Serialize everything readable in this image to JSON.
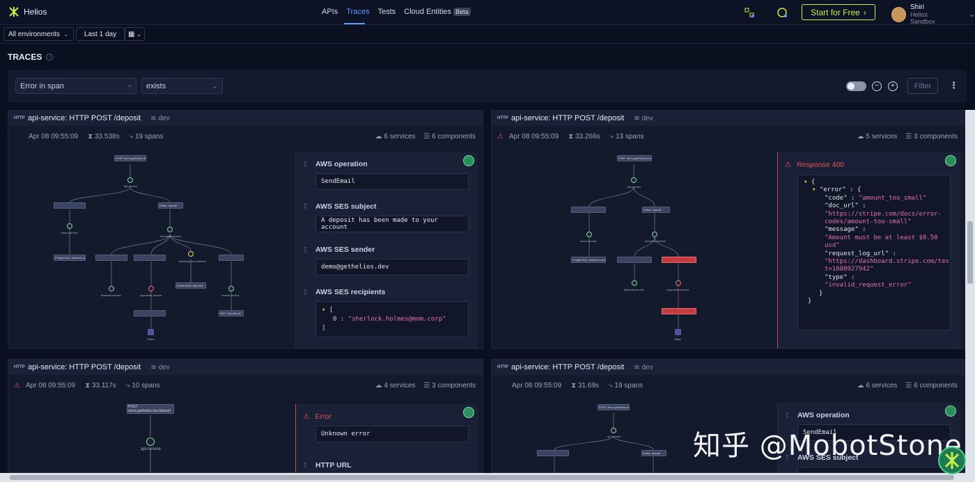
{
  "brand": {
    "name": "Helios"
  },
  "nav": {
    "items": [
      "APIs",
      "Traces",
      "Tests",
      "Cloud Entities"
    ],
    "beta": "Beta",
    "active": "Traces"
  },
  "header": {
    "cta": "Start for Free",
    "user_name": "Shiri",
    "user_org": "Helios Sandbox"
  },
  "toolbar": {
    "environment": "All environments",
    "time_range": "Last 1 day"
  },
  "page": {
    "title": "TRACES"
  },
  "filter": {
    "field": "Error in span",
    "operator": "exists",
    "button": "Filter"
  },
  "cards": [
    {
      "title": "api-service: HTTP POST /deposit",
      "env": "dev",
      "time": "Apr 08 09:55:09",
      "duration": "33.538s",
      "spans": "19 spans",
      "services": "6 services",
      "components": "6 components",
      "error": false,
      "panel": {
        "type": "aws",
        "fields": [
          {
            "label": "AWS operation",
            "value": "SendEmail"
          },
          {
            "label": "AWS SES subject",
            "value": "A deposit has been made to your account"
          },
          {
            "label": "AWS SES sender",
            "value": "demo@gethelios.dev"
          },
          {
            "label": "AWS SES recipients",
            "value": "\"sherlock.holmes@mom.corp\""
          }
        ]
      }
    },
    {
      "title": "api-service: HTTP POST /deposit",
      "env": "dev",
      "time": "Apr 08 09:55:09",
      "duration": "33.266s",
      "spans": "13 spans",
      "services": "5 services",
      "components": "3 components",
      "error": true,
      "panel": {
        "type": "response",
        "label": "Response 400",
        "json": {
          "code": "\"amount_too_small\"",
          "doc_url_1": "\"https://stripe.com/docs/error-",
          "doc_url_2": "codes/amount-too-small\"",
          "message_1": "\"Amount must be at least $0.50",
          "message_2": "usd\"",
          "req_1": "\"https://dashboard.stripe.com/tes",
          "req_2": "t=1680927942\"",
          "type": "\"invalid_request_error\""
        }
      }
    },
    {
      "title": "api-service: HTTP POST /deposit",
      "env": "dev",
      "time": "Apr 08 09:55:09",
      "duration": "33.117s",
      "spans": "10 spans",
      "services": "4 services",
      "components": "3 components",
      "error": true,
      "panel": {
        "type": "error",
        "label": "Error",
        "value": "Unknown error",
        "next_label": "HTTP URL"
      }
    },
    {
      "title": "api-service: HTTP POST /deposit",
      "env": "dev",
      "time": "Apr 08 09:55:09",
      "duration": "31.69s",
      "spans": "19 spans",
      "services": "6 services",
      "components": "6 components",
      "error": false,
      "panel": {
        "type": "aws",
        "fields": [
          {
            "label": "AWS operation",
            "value": "SendEmail"
          },
          {
            "label": "AWS SES subject",
            "value": ""
          }
        ]
      }
    }
  ],
  "graph_labels": {
    "root": "POST demo.gethelios.dev/deposit",
    "api": "api-service",
    "users": "users-service",
    "accounts": "accounts-service",
    "financial": "financial-service",
    "payments": "payments-service",
    "emails": "emails-service",
    "stripe": "Stripe",
    "kafka": "Kafka: deposit",
    "updating": "Updating user balance",
    "dynamo": "DynamoDB: deposits",
    "ses": "SES: SendEmail",
    "postgres": "PostgreSQL: balance-users"
  },
  "watermark": "知乎 @MobotStone"
}
